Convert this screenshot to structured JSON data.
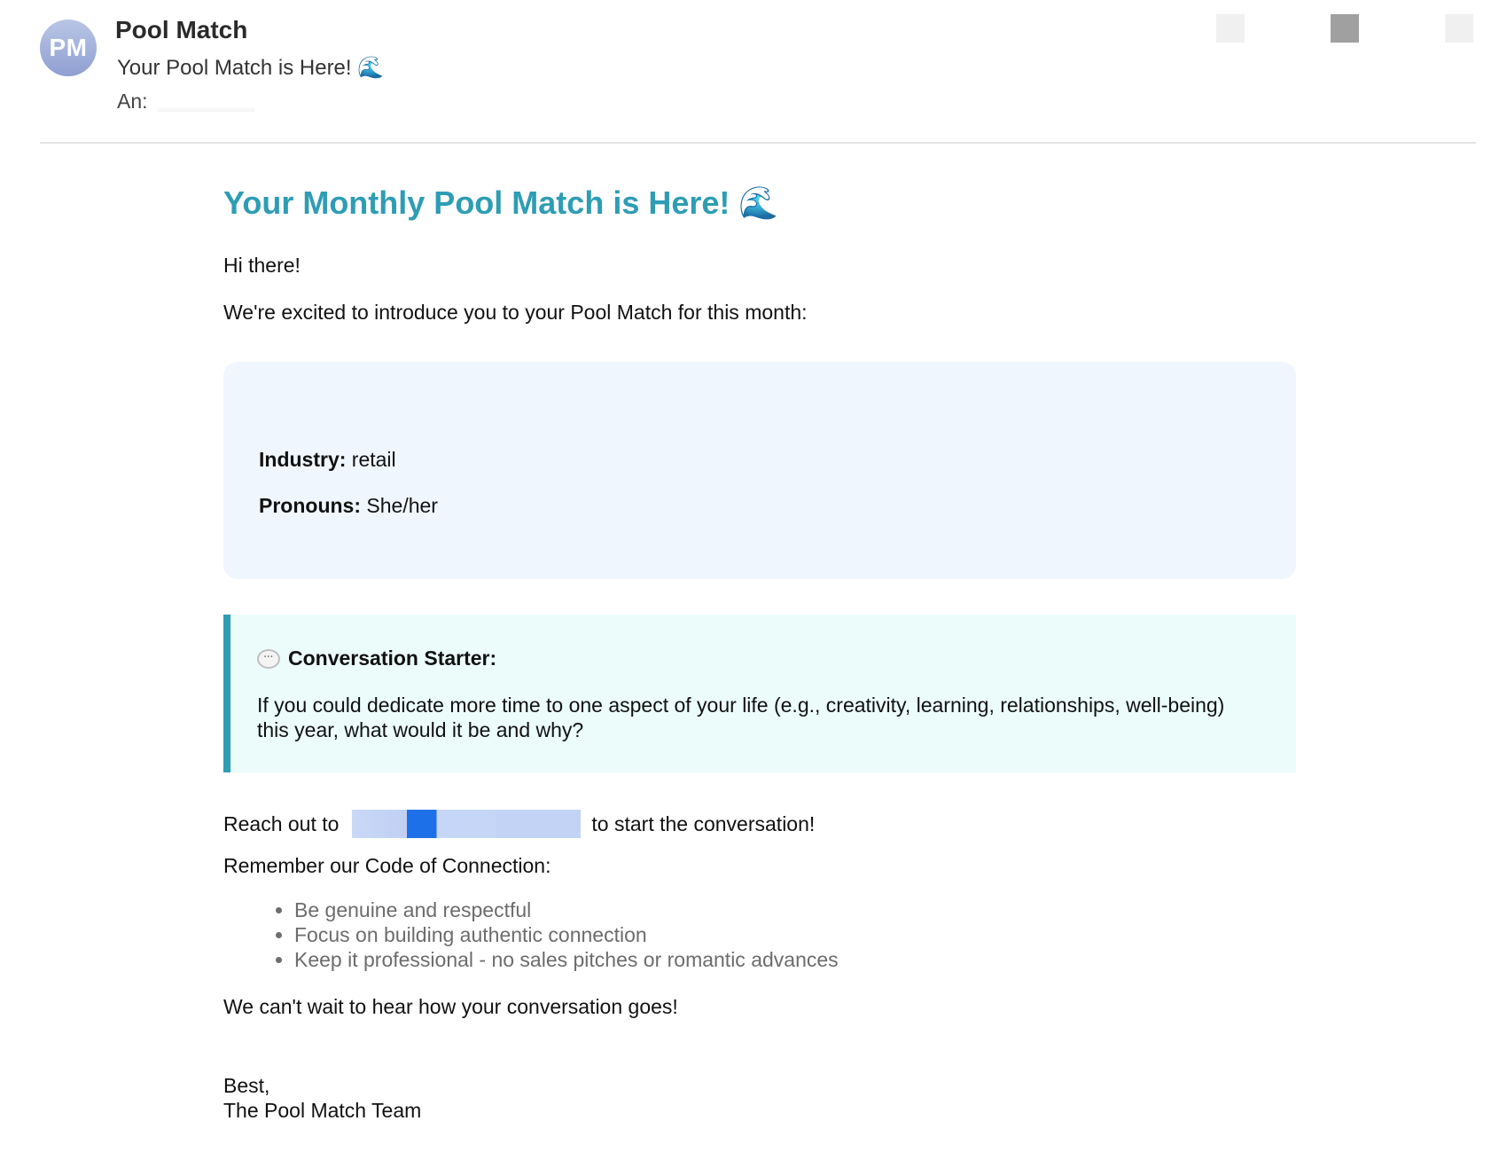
{
  "header": {
    "avatar_initials": "PM",
    "sender": "Pool Match",
    "subject": "Your Pool Match is Here! 🌊",
    "to_label": "An:"
  },
  "email": {
    "title": "Your Monthly Pool Match is Here! 🌊",
    "greeting": "Hi there!",
    "intro": "We're excited to introduce you to your Pool Match for this month:",
    "match": {
      "industry_label": "Industry:",
      "industry_value": "retail",
      "pronouns_label": "Pronouns:",
      "pronouns_value": "She/her"
    },
    "starter": {
      "icon": "speech-bubble-icon",
      "heading": "Conversation Starter:",
      "text": "If you could dedicate more time to one aspect of your life (e.g., creativity, learning, relationships, well-being) this year, what would it be and why?"
    },
    "reach_prefix": "Reach out to",
    "reach_suffix": "to start the conversation!",
    "remember": "Remember our Code of Connection:",
    "code_items": [
      "Be genuine and respectful",
      "Focus on building authentic connection",
      "Keep it professional - no sales pitches or romantic advances"
    ],
    "closing": "We can't wait to hear how your conversation goes!",
    "signoff_1": "Best,",
    "signoff_2": "The Pool Match Team"
  },
  "colors": {
    "accent": "#2e9db4",
    "match_box_bg": "#f0f6fd",
    "starter_box_bg": "#ebfcfb",
    "list_text": "#6c6c6c"
  }
}
